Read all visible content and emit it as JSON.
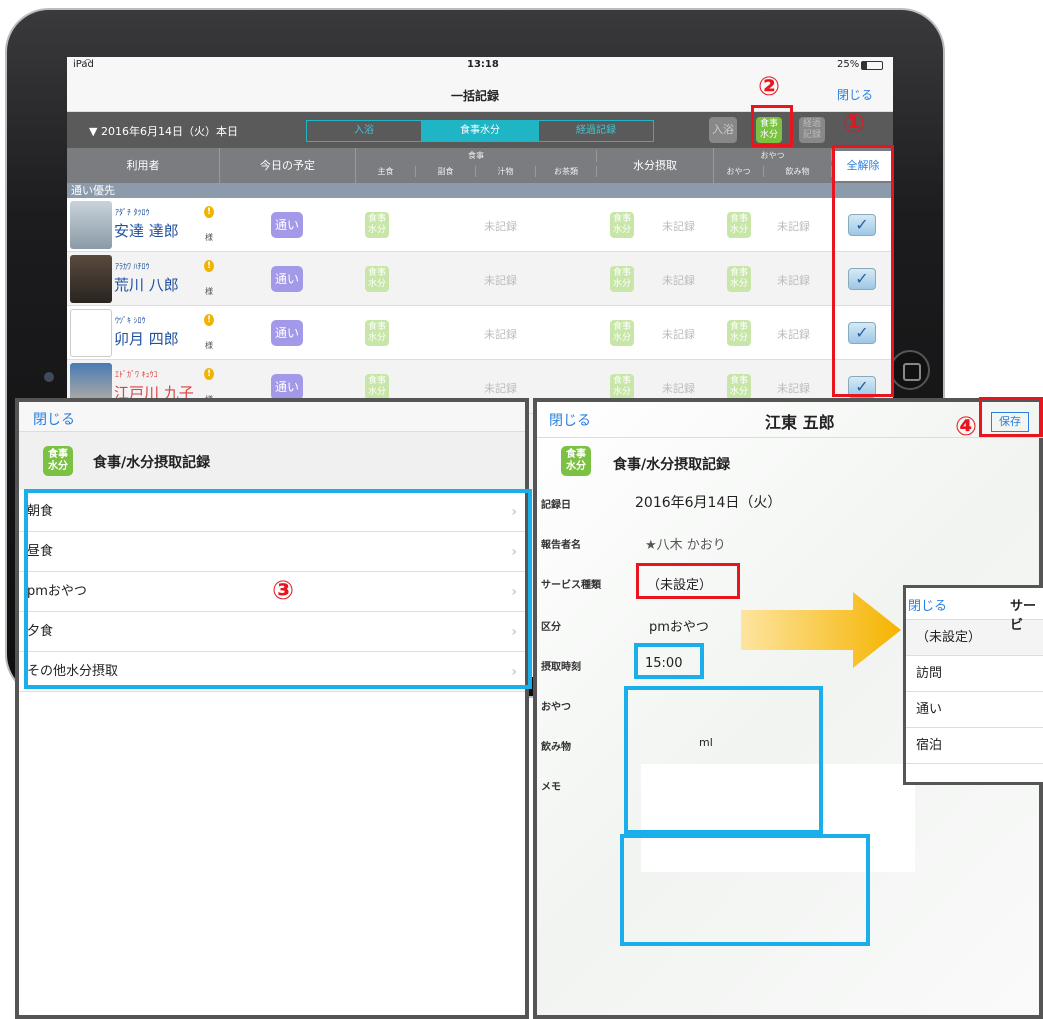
{
  "status": {
    "carrier": "iPad",
    "time": "13:18",
    "battery": "25%"
  },
  "nav": {
    "title": "一括記録",
    "close": "閉じる"
  },
  "toolbar": {
    "date": "▼ 2016年6月14日（火）本日",
    "tabs": [
      "入浴",
      "食事水分",
      "経過記録"
    ],
    "quick_icons": [
      {
        "label": "入浴"
      },
      {
        "label": "食事\n水分"
      },
      {
        "label": "経過\n記録"
      }
    ]
  },
  "table": {
    "headers": {
      "user": "利用者",
      "plan": "今日の予定",
      "meal": "食事",
      "meal_sub": [
        "主食",
        "副食",
        "汁物",
        "お茶類"
      ],
      "water": "水分摂取",
      "snack": "おやつ",
      "snack_sub": [
        "おやつ",
        "飲み物"
      ],
      "clear_all": "全解除"
    },
    "group": "通い優先",
    "rows": [
      {
        "kana": "ｱﾀﾞﾁ ﾀﾂﾛｳ",
        "name": "安達 達郎",
        "name_color": "#2050a0"
      },
      {
        "kana": "ｱﾗｶﾜ ﾊﾁﾛｳ",
        "name": "荒川 八郎",
        "name_color": "#2050a0"
      },
      {
        "kana": "ｳﾂﾞｷ ｼﾛｳ",
        "name": "卯月 四郎",
        "name_color": "#2050a0"
      },
      {
        "kana": "ｴﾄﾞｶﾞﾜ ｷｭｳｺ",
        "name": "江戸川 九子",
        "name_color": "#e04040"
      }
    ],
    "honorific": "様",
    "plan_badge": "通い",
    "meal_icon": "食事\n水分",
    "unrecorded": "未記録",
    "check": "✓"
  },
  "markers": [
    "①",
    "②",
    "③",
    "④"
  ],
  "left_panel": {
    "close": "閉じる",
    "icon": "食事\n水分",
    "title": "食事/水分摂取記録",
    "items": [
      "朝食",
      "昼食",
      "pmおやつ",
      "夕食",
      "その他水分摂取"
    ]
  },
  "right_panel": {
    "close": "閉じる",
    "title": "江東 五郎",
    "save": "保存",
    "icon": "食事\n水分",
    "header": "食事/水分摂取記録",
    "fields": {
      "date_label": "記録日",
      "date_value": "2016年6月14日（火）",
      "reporter_label": "報告者名",
      "reporter_value": "★八木 かおり",
      "service_label": "サービス種類",
      "service_value": "（未設定）",
      "category_label": "区分",
      "category_value": "pmおやつ",
      "time_label": "摂取時刻",
      "time_value": "15:00",
      "snack_label": "おやつ",
      "drink_label": "飲み物",
      "drink_unit": "ml",
      "memo_label": "メモ"
    }
  },
  "popup": {
    "close": "閉じる",
    "title": "サービ",
    "options": [
      "（未設定）",
      "訪問",
      "通い",
      "宿泊"
    ]
  },
  "colors": {
    "accent": "#20b5c4",
    "marker": "#e8141e",
    "highlight": "#1aaeea",
    "meal_green": "#7bc142"
  }
}
